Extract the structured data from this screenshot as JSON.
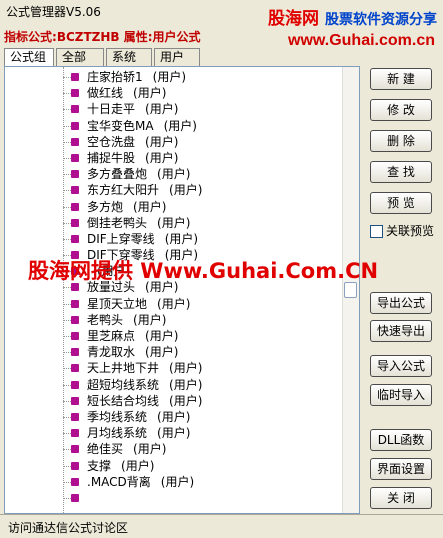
{
  "window": {
    "title": "公式管理器V5.06"
  },
  "brand": {
    "name": "股海网",
    "slogan": "股票软件资源分享",
    "url": "www.Guhai.com.cn"
  },
  "info": {
    "formula_label": "指标公式:",
    "formula_value": "BCZTZHB",
    "attr_label": "属性:",
    "attr_value": "用户公式"
  },
  "tabs": [
    "公式组",
    "全部",
    "系统",
    "用户"
  ],
  "list": [
    {
      "name": "庄家抬轿1",
      "tag": "(用户)"
    },
    {
      "name": "做红线",
      "tag": "(用户)"
    },
    {
      "name": "十日走平",
      "tag": "(用户)"
    },
    {
      "name": "宝华变色MA",
      "tag": "(用户)"
    },
    {
      "name": "空仓洗盘",
      "tag": "(用户)"
    },
    {
      "name": "捕捉牛股",
      "tag": "(用户)"
    },
    {
      "name": "多方叠叠炮",
      "tag": "(用户)"
    },
    {
      "name": "东方红大阳升",
      "tag": "(用户)"
    },
    {
      "name": "多方炮",
      "tag": "(用户)"
    },
    {
      "name": "倒挂老鸭头",
      "tag": "(用户)"
    },
    {
      "name": "DIF上穿零线",
      "tag": "(用户)"
    },
    {
      "name": "DIF下穿零线",
      "tag": "(用户)"
    },
    {
      "name": "",
      "tag": "(用户)"
    },
    {
      "name": "放量过头",
      "tag": "(用户)"
    },
    {
      "name": "星顶天立地",
      "tag": "(用户)"
    },
    {
      "name": "老鸭头",
      "tag": "(用户)"
    },
    {
      "name": "里芝麻点",
      "tag": "(用户)"
    },
    {
      "name": "青龙取水",
      "tag": "(用户)"
    },
    {
      "name": "天上井地下井",
      "tag": "(用户)"
    },
    {
      "name": "超短均线系统",
      "tag": "(用户)"
    },
    {
      "name": "短长结合均线",
      "tag": "(用户)"
    },
    {
      "name": "季均线系统",
      "tag": "(用户)"
    },
    {
      "name": "月均线系统",
      "tag": "(用户)"
    },
    {
      "name": "绝佳买",
      "tag": "(用户)"
    },
    {
      "name": "支撑",
      "tag": "(用户)"
    },
    {
      "name": ".MACD背离",
      "tag": "(用户)"
    },
    {
      "name": "",
      "tag": ""
    }
  ],
  "buttons": {
    "new": "新 建",
    "modify": "修 改",
    "delete": "删 除",
    "find": "查 找",
    "preview": "预 览",
    "export": "导出公式",
    "quick_export": "快速导出",
    "import": "导入公式",
    "temp_import": "临时导入",
    "dll": "DLL函数",
    "ui_settings": "界面设置",
    "close": "关 闭"
  },
  "preview_toggle": {
    "label": "关联预览",
    "checked": false
  },
  "watermark": "股海网提供 Www.Guhai.Com.CN",
  "status": "访问通达信公式讨论区"
}
